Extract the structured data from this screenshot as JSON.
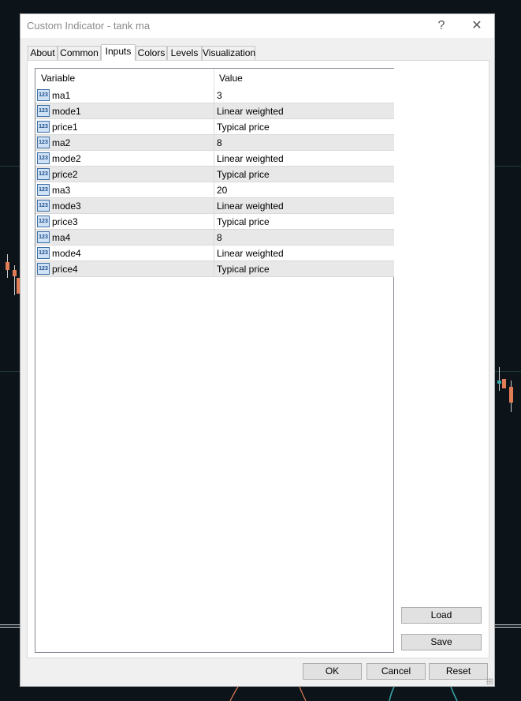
{
  "window": {
    "title": "Custom Indicator - tank ma",
    "help_glyph": "?",
    "close_glyph": "✕"
  },
  "tabs": [
    {
      "label": "About"
    },
    {
      "label": "Common"
    },
    {
      "label": "Inputs",
      "active": true
    },
    {
      "label": "Colors"
    },
    {
      "label": "Levels"
    },
    {
      "label": "Visualization"
    }
  ],
  "grid": {
    "columns": [
      "Variable",
      "Value"
    ],
    "icon_text": "123",
    "rows": [
      {
        "variable": "ma1",
        "value": "3"
      },
      {
        "variable": "mode1",
        "value": "Linear weighted"
      },
      {
        "variable": "price1",
        "value": "Typical price"
      },
      {
        "variable": "ma2",
        "value": "8"
      },
      {
        "variable": "mode2",
        "value": "Linear weighted"
      },
      {
        "variable": "price2",
        "value": "Typical price"
      },
      {
        "variable": "ma3",
        "value": "20"
      },
      {
        "variable": "mode3",
        "value": "Linear weighted"
      },
      {
        "variable": "price3",
        "value": "Typical price"
      },
      {
        "variable": "ma4",
        "value": "8"
      },
      {
        "variable": "mode4",
        "value": "Linear weighted"
      },
      {
        "variable": "price4",
        "value": "Typical price"
      }
    ]
  },
  "side_buttons": {
    "load": "Load",
    "save": "Save"
  },
  "footer_buttons": {
    "ok": "OK",
    "cancel": "Cancel",
    "reset": "Reset"
  }
}
